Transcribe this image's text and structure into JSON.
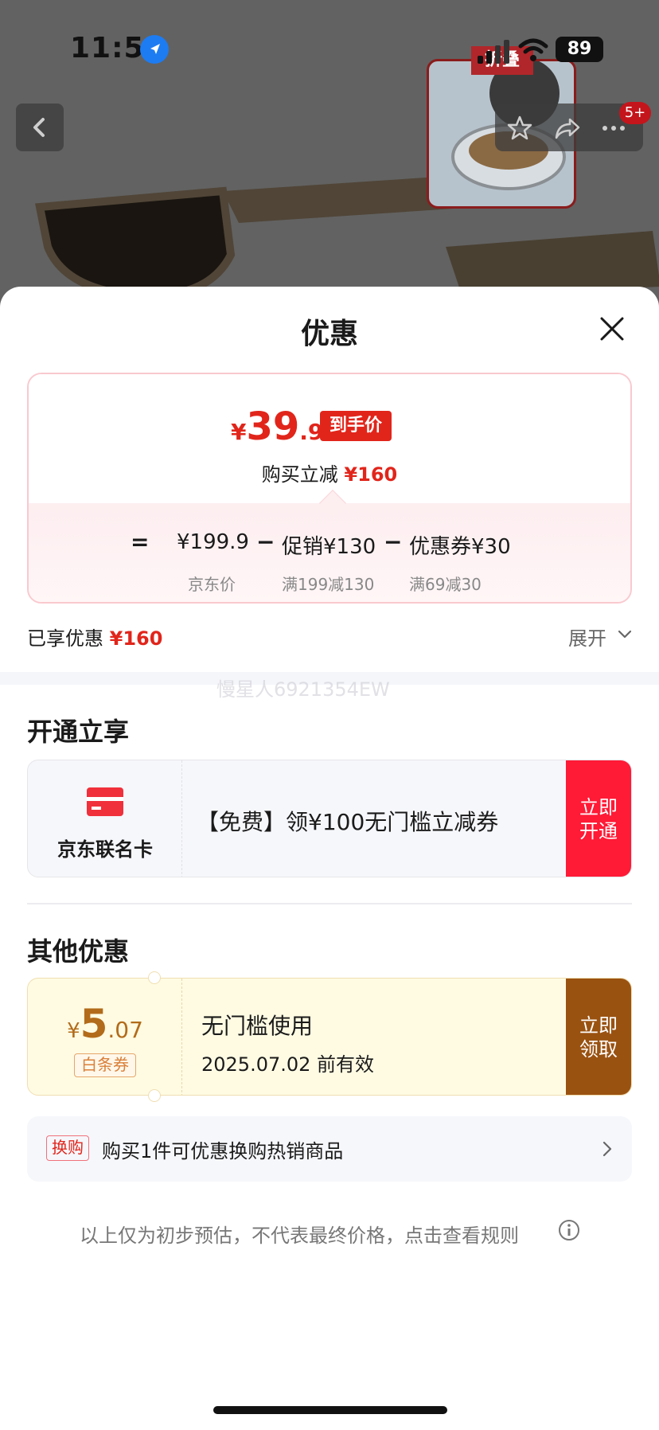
{
  "status_bar": {
    "time": "11:51",
    "battery": "89"
  },
  "background": {
    "thumb_tag": "折叠",
    "notification_badge": "5+"
  },
  "sheet": {
    "title": "优惠",
    "price_card": {
      "currency": "¥",
      "final_int": "39",
      "final_dec": ".9",
      "final_tag": "到手价",
      "reduce_label": "购买立减",
      "reduce_amount": "¥160",
      "calc": {
        "eq": "=",
        "minus": "−",
        "items": [
          {
            "value": "¥199.9",
            "sub": "京东价"
          },
          {
            "value": "促销¥130",
            "sub": "满199减130"
          },
          {
            "value": "优惠券¥30",
            "sub": "满69减30"
          }
        ]
      }
    },
    "enjoyed_label": "已享优惠",
    "enjoyed_amount": "¥160",
    "expand_label": "展开",
    "watermark": "慢星人6921354EW",
    "open_section": {
      "title": "开通立享",
      "card_name": "京东联名卡",
      "description": "【免费】领¥100无门槛立减券",
      "button_line1": "立即",
      "button_line2": "开通"
    },
    "other_section": {
      "title": "其他优惠",
      "coupon": {
        "currency": "¥",
        "int": "5",
        "dec": ".07",
        "type": "白条券",
        "title": "无门槛使用",
        "validity": "2025.07.02 前有效",
        "button_line1": "立即",
        "button_line2": "领取"
      }
    },
    "exchange": {
      "tag": "换购",
      "text": "购买1件可优惠换购热销商品"
    },
    "disclaimer": "以上仅为初步预估，不代表最终价格，点击查看规则"
  },
  "colors": {
    "accent_red": "#e1251b",
    "open_button": "#ff1a36",
    "claim_button": "#9a5211"
  }
}
